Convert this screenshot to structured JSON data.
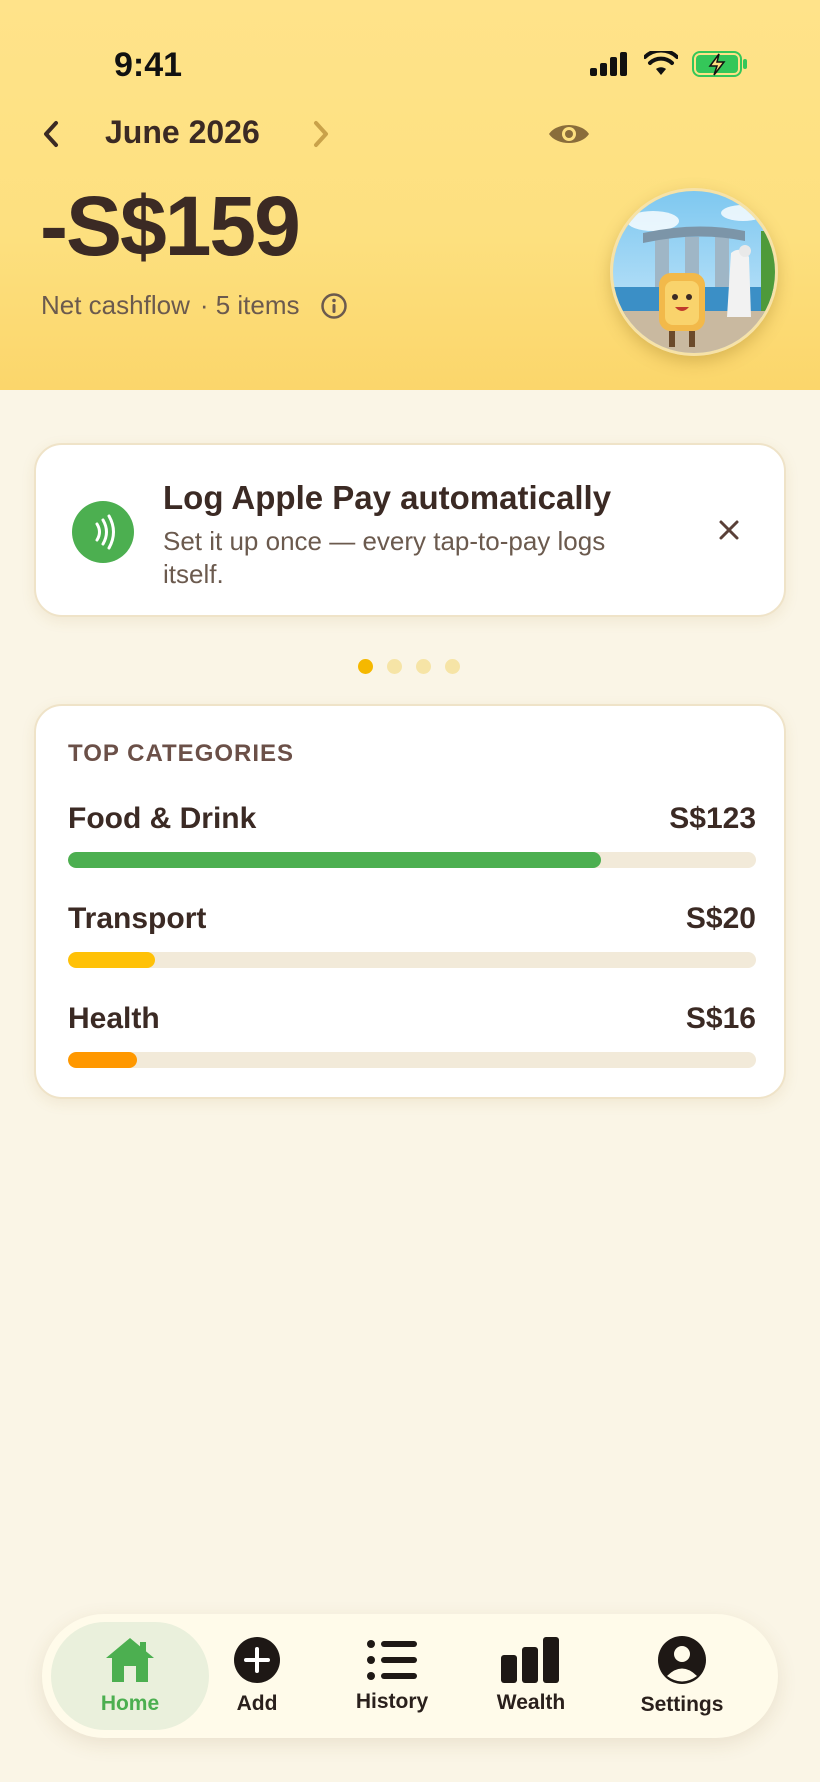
{
  "status_bar": {
    "time": "9:41"
  },
  "header": {
    "month": "June 2026",
    "amount": "-S$159",
    "net_label": "Net cashflow",
    "items_label": "· 5 items"
  },
  "promo": {
    "title": "Log Apple Pay automatically",
    "description": "Set it up once — every tap-to-pay logs itself."
  },
  "carousel": {
    "count": 4,
    "active_index": 0
  },
  "categories": {
    "heading": "TOP CATEGORIES",
    "items": [
      {
        "name": "Food & Drink",
        "amount": "S$123",
        "fill": 0.775,
        "color": "#4caf50"
      },
      {
        "name": "Transport",
        "amount": "S$20",
        "fill": 0.126,
        "color": "#ffc107"
      },
      {
        "name": "Health",
        "amount": "S$16",
        "fill": 0.1,
        "color": "#ff9800"
      }
    ]
  },
  "tabbar": {
    "tabs": [
      {
        "label": "Home",
        "icon": "home-icon",
        "active": true
      },
      {
        "label": "Add",
        "icon": "plus-circle-icon",
        "active": false
      },
      {
        "label": "History",
        "icon": "list-icon",
        "active": false
      },
      {
        "label": "Wealth",
        "icon": "bar-chart-icon",
        "active": false
      },
      {
        "label": "Settings",
        "icon": "person-circle-icon",
        "active": false
      }
    ]
  },
  "colors": {
    "header_bg": "#fde07f",
    "accent_green": "#4caf50",
    "text_dark": "#3b2a24"
  }
}
